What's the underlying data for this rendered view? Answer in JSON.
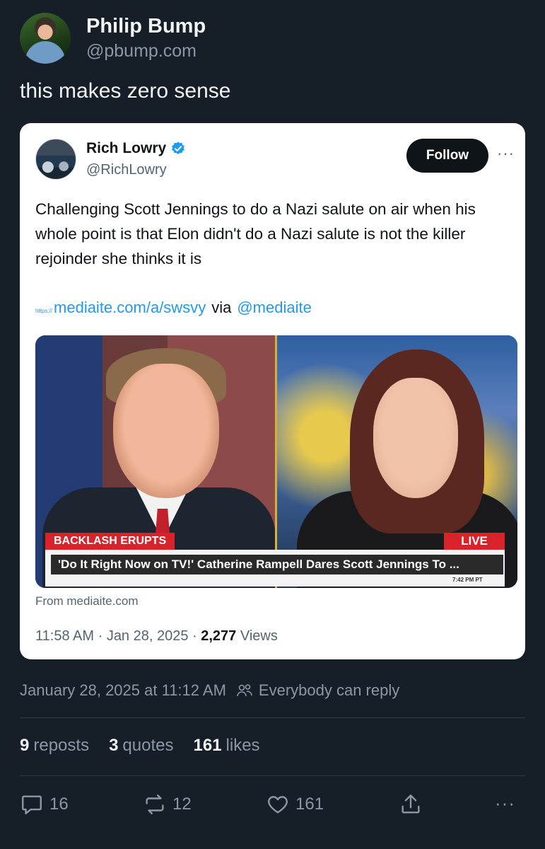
{
  "post": {
    "author_name": "Philip Bump",
    "author_handle": "@pbump.com",
    "text": "this makes zero sense"
  },
  "embed": {
    "author_name": "Rich Lowry",
    "author_handle": "@RichLowry",
    "follow_label": "Follow",
    "more_label": "···",
    "body": "Challenging Scott Jennings to do a Nazi salute on air when his whole point is that Elon didn't do a Nazi salute is not the killer rejoinder she thinks it is",
    "link_prefix": "https://",
    "link": "mediaite.com/a/swsvy",
    "via": "via",
    "mention": "@mediaite",
    "media": {
      "banner_tag": "BACKLASH ERUPTS",
      "live_tag": "LIVE",
      "headline": "'Do It Right Now on TV!' Catherine Rampell Dares Scott Jennings To ...",
      "time": "7:42 PM PT"
    },
    "from_source": "From mediaite.com",
    "time": "11:58 AM",
    "date": "Jan 28, 2025",
    "views_count": "2,277",
    "views_label": "Views"
  },
  "meta": {
    "timestamp": "January 28, 2025 at 11:12 AM",
    "reply_setting": "Everybody can reply"
  },
  "stats": {
    "reposts_count": "9",
    "reposts_label": "reposts",
    "quotes_count": "3",
    "quotes_label": "quotes",
    "likes_count": "161",
    "likes_label": "likes"
  },
  "actions": {
    "replies": "16",
    "reposts": "12",
    "likes": "161",
    "more": "···"
  },
  "colors": {
    "background": "#161e27",
    "accent": "#1d9bf0",
    "muted": "#8b98a5"
  }
}
